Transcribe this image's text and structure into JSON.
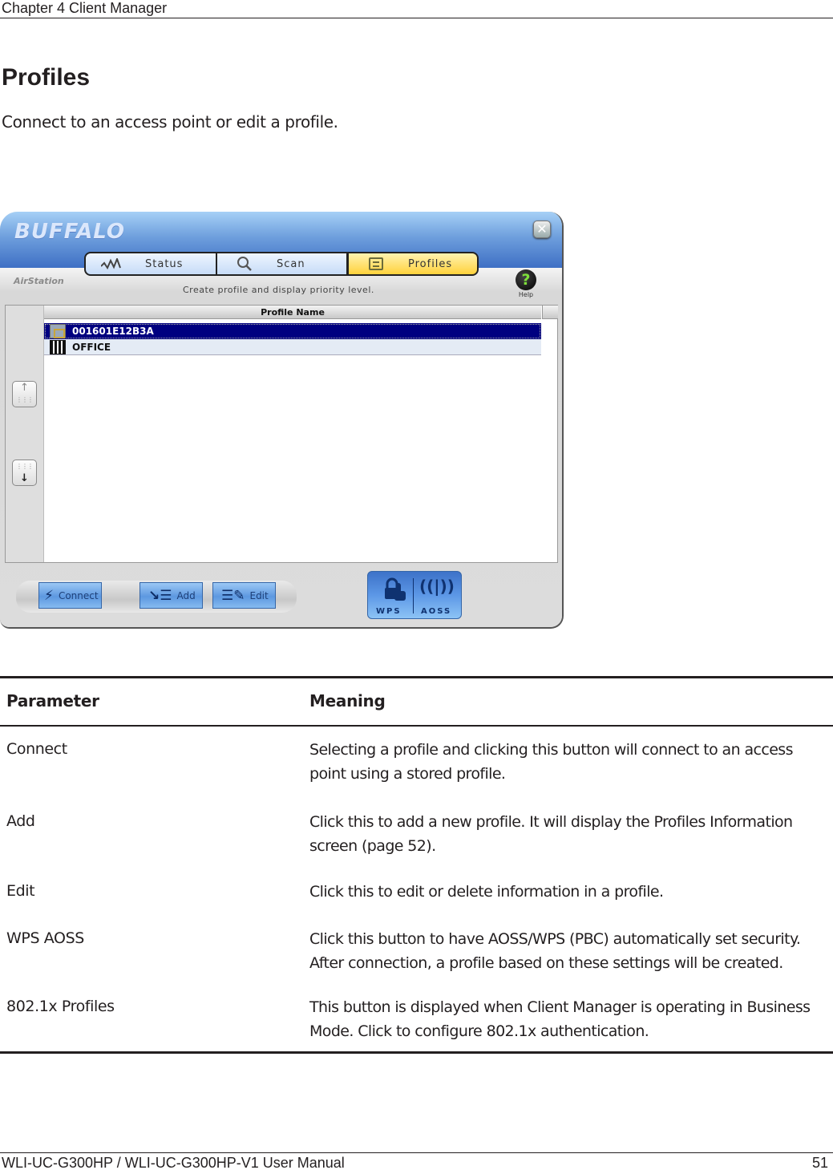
{
  "header": {
    "chapter": "Chapter 4  Client Manager"
  },
  "section": {
    "title": "Profiles",
    "intro": "Connect to an access point or edit a profile."
  },
  "app": {
    "brand": "BUFFALO",
    "close_icon": "close-icon",
    "tabs": [
      {
        "label": "Status",
        "icon": "activity-wave-icon"
      },
      {
        "label": "Scan",
        "icon": "magnifier-icon"
      },
      {
        "label": "Profiles",
        "icon": "list-icon",
        "active": true
      }
    ],
    "sublogo": "AirStation",
    "subtitle": "Create profile and display priority level.",
    "help_label": "Help",
    "help_glyph": "?",
    "list": {
      "column_header": "Profile Name",
      "rows": [
        {
          "name": "001601E12B3A",
          "icon": "home-network-icon",
          "selected": true
        },
        {
          "name": "OFFICE",
          "icon": "building-icon",
          "selected": false
        }
      ]
    },
    "move_up_glyph": "↑",
    "move_down_glyph": "↓",
    "dots": "⋮⋮⋮",
    "buttons": {
      "connect": {
        "label": "Connect",
        "glyph": "⚡"
      },
      "add": {
        "label": "Add",
        "glyph": "↘☰"
      },
      "edit": {
        "label": "Edit",
        "glyph": "☰✎"
      },
      "wps": "WPS",
      "aoss": "AOSS",
      "wps_glyph": "🔒",
      "aoss_glyph": "((|))"
    },
    "colors": {
      "title_bar": "#3e6fc4",
      "active_tab": "#ffd23c",
      "selected_row": "#000080",
      "action_button": "#5d98e0"
    }
  },
  "table": {
    "headers": {
      "parameter": "Parameter",
      "meaning": "Meaning"
    },
    "rows": [
      {
        "parameter": "Connect",
        "meaning": "Selecting a profile and clicking this button will connect to an access point using a stored profile."
      },
      {
        "parameter": "Add",
        "meaning": "Click this to add a new profile.  It will display the Profiles Information screen (page 52)."
      },
      {
        "parameter": "Edit",
        "meaning": "Click this to edit or delete information in a profile."
      },
      {
        "parameter": "WPS  AOSS",
        "meaning": "Click this button to have AOSS/WPS (PBC) automatically set security. After connection, a profile based on these settings will be created."
      },
      {
        "parameter": "802.1x Profiles",
        "meaning": "This button is displayed when Client Manager is operating in Business Mode.  Click to configure 802.1x authentication."
      }
    ]
  },
  "footer": {
    "manual": "WLI-UC-G300HP / WLI-UC-G300HP-V1 User Manual",
    "page": "51"
  }
}
